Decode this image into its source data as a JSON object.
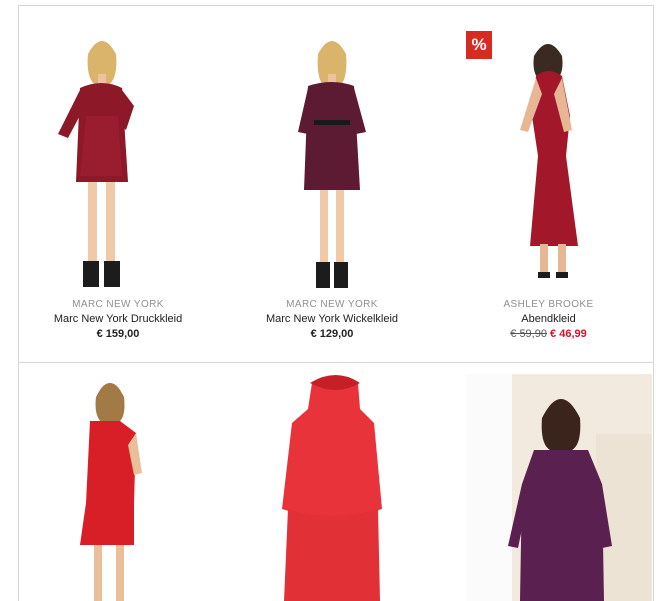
{
  "products": [
    {
      "brand": "MARC NEW YORK",
      "name": "Marc New York Druckkleid",
      "price": "€ 159,00",
      "dress_color": "#8c1828"
    },
    {
      "brand": "MARC NEW YORK",
      "name": "Marc New York Wickelkleid",
      "price": "€ 129,00",
      "dress_color": "#5c1a33"
    },
    {
      "brand": "ASHLEY BROOKE",
      "name": "Abendkleid",
      "old_price": "€ 59,90",
      "sale_price": "€ 46,99",
      "badge": "%",
      "dress_color": "#a3172a"
    },
    {
      "dress_color": "#d81f27"
    },
    {
      "dress_color": "#e8333a"
    },
    {
      "dress_color": "#5a2150"
    }
  ],
  "colors": {
    "sale": "#d2142a",
    "badge": "#d72a21",
    "brand_text": "#8f8f8f"
  }
}
